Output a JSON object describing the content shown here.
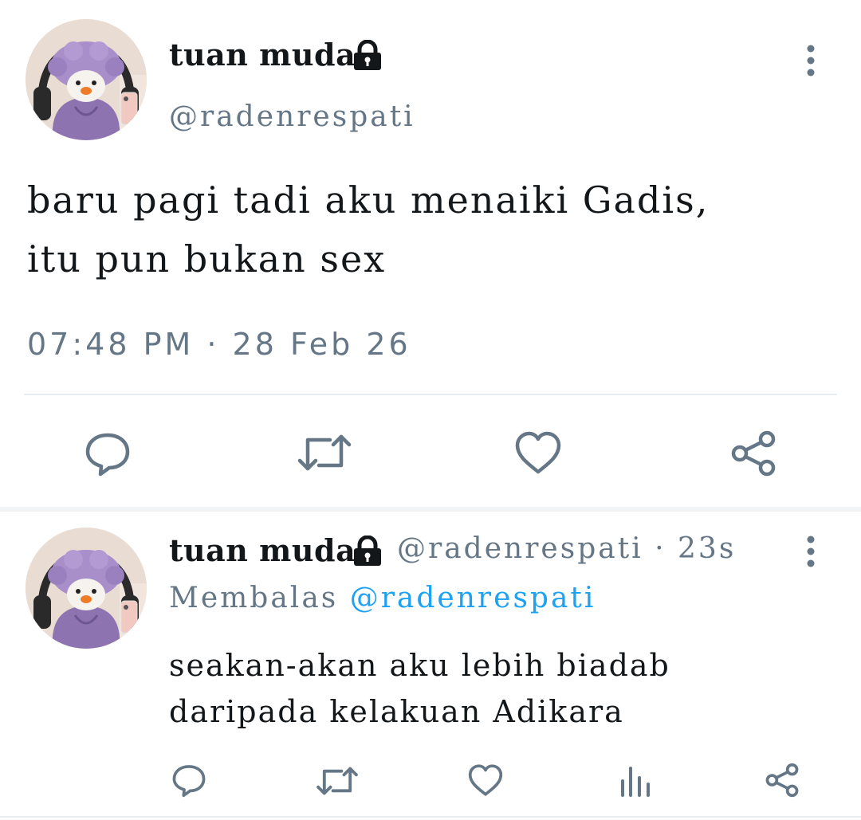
{
  "main_tweet": {
    "author_name": "tuan muda",
    "handle": "@radenrespati",
    "text_line1": "baru pagi tadi aku menaiki Gadis,",
    "text_line2": "itu pun bukan sex",
    "timestamp": "07:48 PM · 28 Feb 26",
    "avatar_icon": "penguin-plush-avatar",
    "lock_icon": "lock-icon",
    "more_icon": "more-vertical-icon",
    "actions": [
      "reply-icon",
      "retweet-icon",
      "like-icon",
      "share-icon"
    ]
  },
  "reply_tweet": {
    "author_name": "tuan muda",
    "handle": "@radenrespati",
    "time_ago": "· 23s",
    "replying_label": "Membalas",
    "replying_to": "@radenrespati",
    "text_line1": "seakan-akan aku lebih biadab",
    "text_line2": "daripada kelakuan Adikara",
    "actions": [
      "reply-icon",
      "retweet-icon",
      "like-icon",
      "stats-icon",
      "share-icon"
    ]
  },
  "colors": {
    "text": "#14171a",
    "secondary": "#657786",
    "link": "#1da1f2",
    "divider": "#e6ecf0"
  }
}
